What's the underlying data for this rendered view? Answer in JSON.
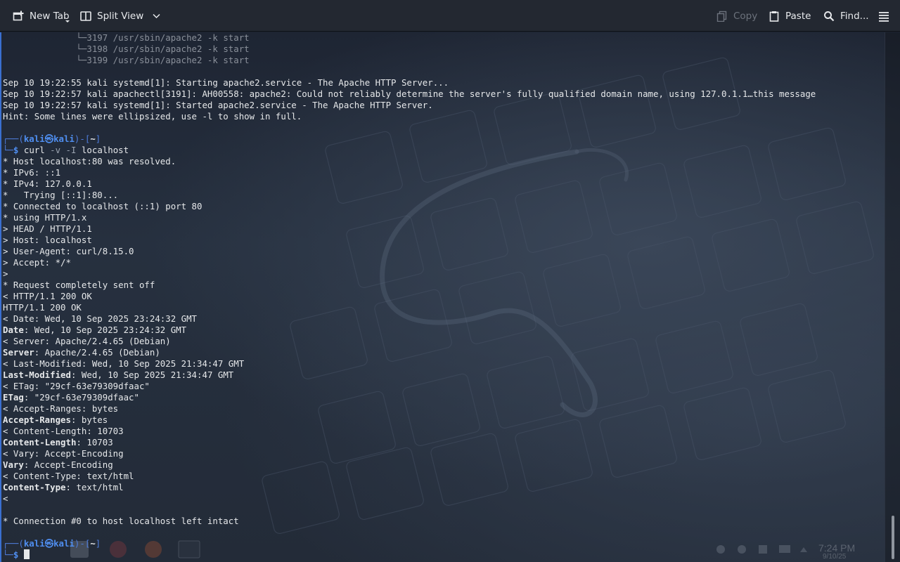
{
  "toolbar": {
    "new_tab_label": "New Tab",
    "split_view_label": "Split View",
    "copy_label": "Copy",
    "paste_label": "Paste",
    "find_label": "Find...",
    "copy_enabled": false
  },
  "terminal": {
    "tree_lines": [
      "3197 /usr/sbin/apache2 -k start",
      "3198 /usr/sbin/apache2 -k start",
      "3199 /usr/sbin/apache2 -k start"
    ],
    "log_lines": [
      "Sep 10 19:22:55 kali systemd[1]: Starting apache2.service - The Apache HTTP Server...",
      "Sep 10 19:22:57 kali apachectl[3191]: AH00558: apache2: Could not reliably determine the server's fully qualified domain name, using 127.0.1.1…this message",
      "Sep 10 19:22:57 kali systemd[1]: Started apache2.service - The Apache HTTP Server.",
      "Hint: Some lines were ellipsized, use -l to show in full."
    ],
    "prompt": {
      "user": "kali",
      "host": "kali",
      "dir": "~",
      "at": "㉿"
    },
    "command": {
      "name": "curl",
      "flags": "-v -I",
      "arg": "localhost"
    },
    "output_lines": [
      {
        "prefix": "",
        "key": "",
        "rest": "* Host localhost:80 was resolved."
      },
      {
        "prefix": "",
        "key": "",
        "rest": "* IPv6: ::1"
      },
      {
        "prefix": "",
        "key": "",
        "rest": "* IPv4: 127.0.0.1"
      },
      {
        "prefix": "",
        "key": "",
        "rest": "*   Trying [::1]:80..."
      },
      {
        "prefix": "",
        "key": "",
        "rest": "* Connected to localhost (::1) port 80"
      },
      {
        "prefix": "",
        "key": "",
        "rest": "* using HTTP/1.x"
      },
      {
        "prefix": "",
        "key": "",
        "rest": "> HEAD / HTTP/1.1"
      },
      {
        "prefix": "",
        "key": "",
        "rest": "> Host: localhost"
      },
      {
        "prefix": "",
        "key": "",
        "rest": "> User-Agent: curl/8.15.0"
      },
      {
        "prefix": "",
        "key": "",
        "rest": "> Accept: */*"
      },
      {
        "prefix": "",
        "key": "",
        "rest": ">"
      },
      {
        "prefix": "",
        "key": "",
        "rest": "* Request completely sent off"
      },
      {
        "prefix": "",
        "key": "",
        "rest": "< HTTP/1.1 200 OK"
      },
      {
        "prefix": "",
        "key": "",
        "rest": "HTTP/1.1 200 OK"
      },
      {
        "prefix": "",
        "key": "",
        "rest": "< Date: Wed, 10 Sep 2025 23:24:32 GMT"
      },
      {
        "prefix": "",
        "key": "Date",
        "rest": ": Wed, 10 Sep 2025 23:24:32 GMT"
      },
      {
        "prefix": "",
        "key": "",
        "rest": "< Server: Apache/2.4.65 (Debian)"
      },
      {
        "prefix": "",
        "key": "Server",
        "rest": ": Apache/2.4.65 (Debian)"
      },
      {
        "prefix": "",
        "key": "",
        "rest": "< Last-Modified: Wed, 10 Sep 2025 21:34:47 GMT"
      },
      {
        "prefix": "",
        "key": "Last-Modified",
        "rest": ": Wed, 10 Sep 2025 21:34:47 GMT"
      },
      {
        "prefix": "",
        "key": "",
        "rest": "< ETag: \"29cf-63e79309dfaac\""
      },
      {
        "prefix": "",
        "key": "ETag",
        "rest": ": \"29cf-63e79309dfaac\""
      },
      {
        "prefix": "",
        "key": "",
        "rest": "< Accept-Ranges: bytes"
      },
      {
        "prefix": "",
        "key": "Accept-Ranges",
        "rest": ": bytes"
      },
      {
        "prefix": "",
        "key": "",
        "rest": "< Content-Length: 10703"
      },
      {
        "prefix": "",
        "key": "Content-Length",
        "rest": ": 10703"
      },
      {
        "prefix": "",
        "key": "",
        "rest": "< Vary: Accept-Encoding"
      },
      {
        "prefix": "",
        "key": "Vary",
        "rest": ": Accept-Encoding"
      },
      {
        "prefix": "",
        "key": "",
        "rest": "< Content-Type: text/html"
      },
      {
        "prefix": "",
        "key": "Content-Type",
        "rest": ": text/html"
      },
      {
        "prefix": "",
        "key": "",
        "rest": "<"
      },
      {
        "prefix": "",
        "key": "",
        "rest": ""
      },
      {
        "prefix": "",
        "key": "",
        "rest": "* Connection #0 to host localhost left intact"
      }
    ]
  },
  "taskbar_ghost": {
    "time": "7:24 PM",
    "date": "9/10/25"
  },
  "colors": {
    "accent": "#4f8ef0",
    "prompt_frame": "#4f7ddc",
    "text": "#e6e8ea",
    "dim": "#8a909a",
    "toolbar_bg": "#232831"
  },
  "icons": {
    "new_tab": "new-tab-icon",
    "split_view": "split-view-icon",
    "copy": "copy-icon",
    "paste": "paste-icon",
    "find": "search-icon",
    "menu": "hamburger-menu-icon"
  }
}
